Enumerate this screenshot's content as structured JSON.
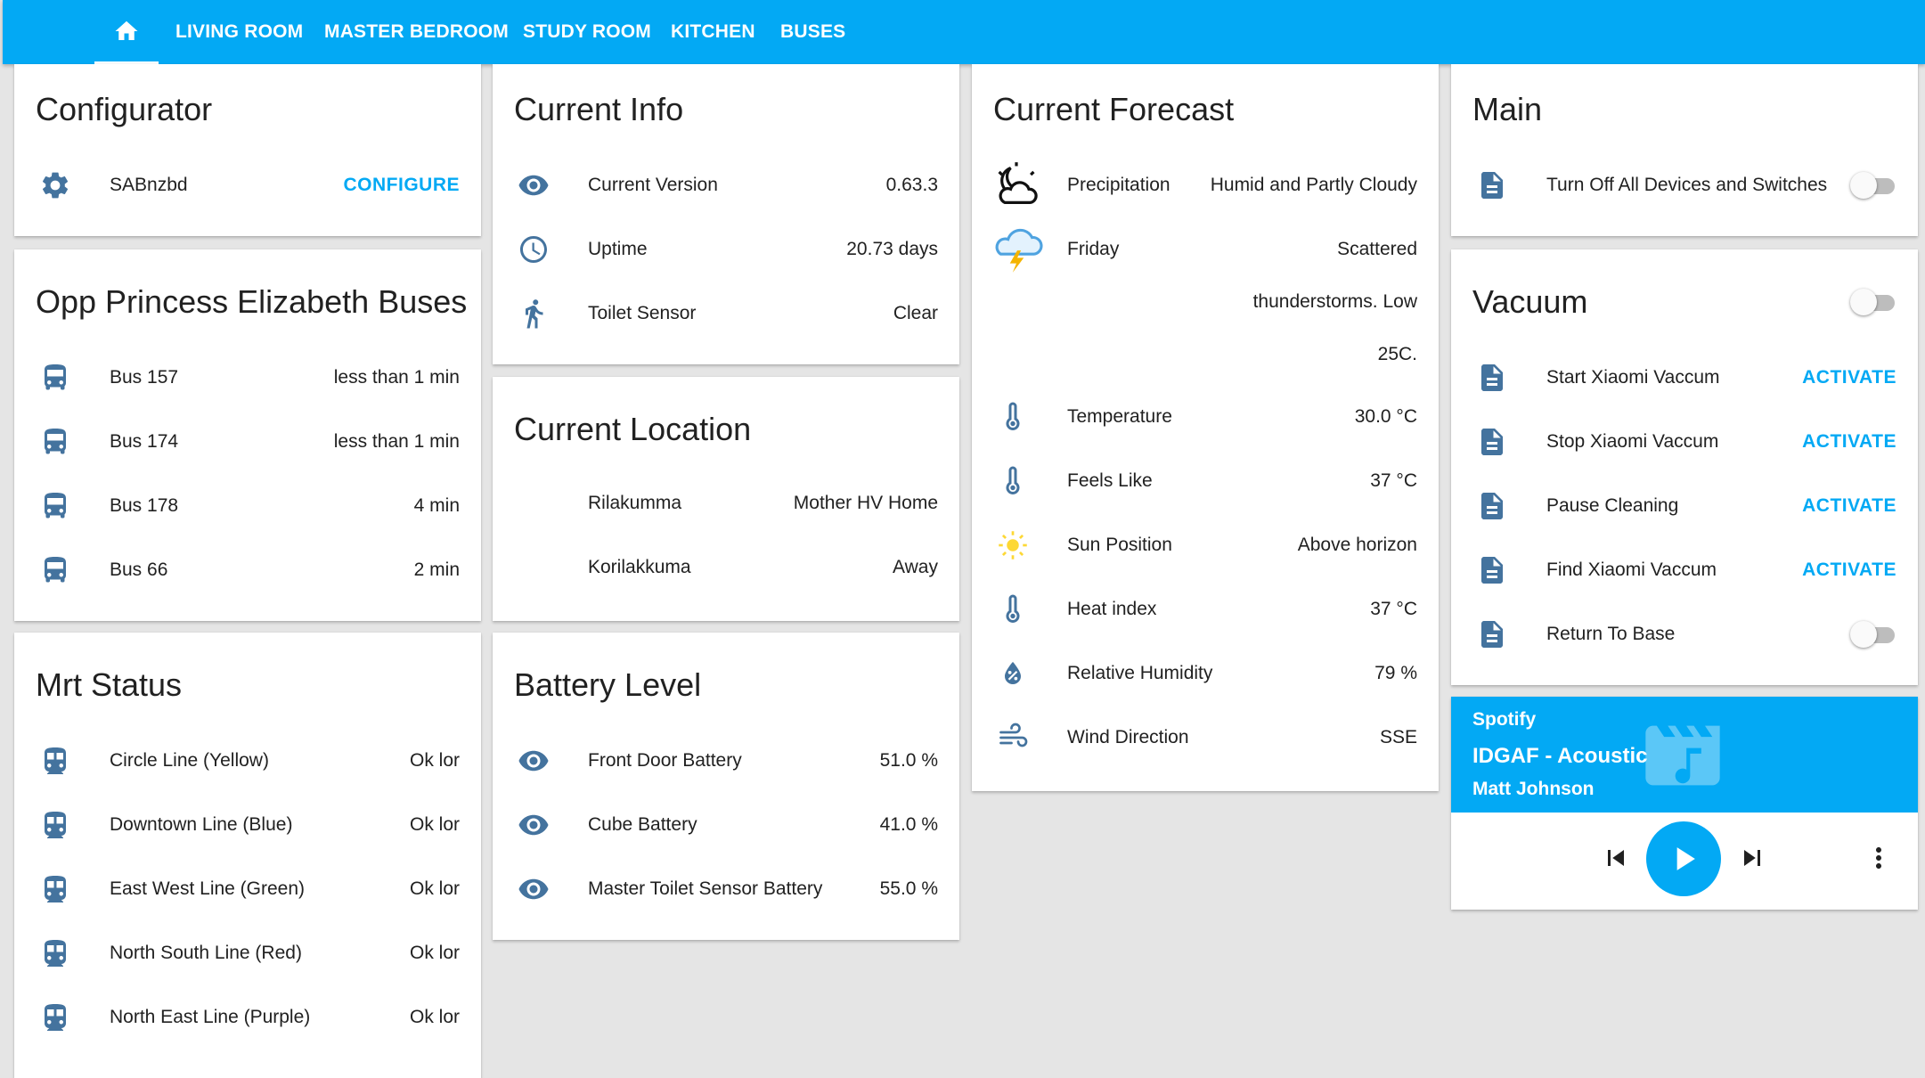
{
  "nav": {
    "tabs": [
      "LIVING ROOM",
      "MASTER BEDROOM",
      "STUDY ROOM",
      "KITCHEN",
      "BUSES"
    ]
  },
  "configurator": {
    "title": "Configurator",
    "item": "SABnzbd",
    "action": "CONFIGURE"
  },
  "buses": {
    "title": "Opp Princess Elizabeth Buses",
    "rows": [
      {
        "label": "Bus 157",
        "value": "less than 1 min"
      },
      {
        "label": "Bus 174",
        "value": "less than 1 min"
      },
      {
        "label": "Bus 178",
        "value": "4 min"
      },
      {
        "label": "Bus 66",
        "value": "2 min"
      }
    ]
  },
  "mrt": {
    "title": "Mrt Status",
    "rows": [
      {
        "label": "Circle Line (Yellow)",
        "value": "Ok lor"
      },
      {
        "label": "Downtown Line (Blue)",
        "value": "Ok lor"
      },
      {
        "label": "East West Line (Green)",
        "value": "Ok lor"
      },
      {
        "label": "North South Line (Red)",
        "value": "Ok lor"
      },
      {
        "label": "North East Line (Purple)",
        "value": "Ok lor"
      }
    ]
  },
  "current_info": {
    "title": "Current Info",
    "rows": [
      {
        "label": "Current Version",
        "value": "0.63.3",
        "icon": "eye-icon"
      },
      {
        "label": "Uptime",
        "value": "20.73 days",
        "icon": "clock-icon"
      },
      {
        "label": "Toilet Sensor",
        "value": "Clear",
        "icon": "walking-person-icon"
      }
    ]
  },
  "location": {
    "title": "Current Location",
    "rows": [
      {
        "label": "Rilakumma",
        "value": "Mother HV Home"
      },
      {
        "label": "Korilakkuma",
        "value": "Away"
      }
    ]
  },
  "battery": {
    "title": "Battery Level",
    "rows": [
      {
        "label": "Front Door Battery",
        "value": "51.0 %"
      },
      {
        "label": "Cube Battery",
        "value": "41.0 %"
      },
      {
        "label": "Master Toilet Sensor Battery",
        "value": "55.0 %"
      }
    ]
  },
  "forecast": {
    "title": "Current Forecast",
    "precipitation_label": "Precipitation",
    "precipitation_value": "Humid and Partly Cloudy",
    "friday_label": "Friday",
    "friday_value_lines": [
      "Scattered",
      "thunderstorms. Low",
      "25C."
    ],
    "rows": [
      {
        "label": "Temperature",
        "value": "30.0 °C",
        "icon": "thermometer-icon"
      },
      {
        "label": "Feels Like",
        "value": "37 °C",
        "icon": "thermometer-icon"
      },
      {
        "label": "Sun Position",
        "value": "Above horizon",
        "icon": "sun-icon"
      },
      {
        "label": "Heat index",
        "value": "37 °C",
        "icon": "thermometer-icon"
      },
      {
        "label": "Relative Humidity",
        "value": "79 %",
        "icon": "water-percent-icon"
      },
      {
        "label": "Wind Direction",
        "value": "SSE",
        "icon": "wind-icon"
      }
    ]
  },
  "main": {
    "title": "Main",
    "item": "Turn Off All Devices and Switches",
    "toggle_on": false
  },
  "vacuum": {
    "title": "Vacuum",
    "toggle_on": false,
    "rows": [
      {
        "label": "Start Xiaomi Vaccum",
        "action": "ACTIVATE"
      },
      {
        "label": "Stop Xiaomi Vaccum",
        "action": "ACTIVATE"
      },
      {
        "label": "Pause Cleaning",
        "action": "ACTIVATE"
      },
      {
        "label": "Find Xiaomi Vaccum",
        "action": "ACTIVATE"
      }
    ],
    "return_label": "Return To Base",
    "return_toggle_on": false
  },
  "media": {
    "source": "Spotify",
    "track": "IDGAF - Acoustic",
    "artist": "Matt Johnson"
  },
  "colors": {
    "accent": "#03a9f4",
    "icon": "#44739e",
    "background": "#e5e5e5"
  }
}
